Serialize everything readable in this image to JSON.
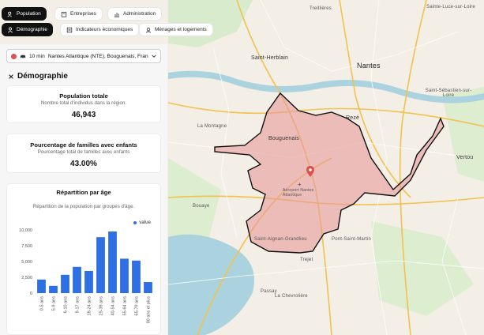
{
  "nav": {
    "row1": [
      {
        "label": "Population",
        "icon": "people-icon",
        "active": true
      },
      {
        "label": "Entreprises",
        "icon": "building-icon",
        "active": false
      },
      {
        "label": "Administration",
        "icon": "chart-icon",
        "active": false
      }
    ],
    "row2": [
      {
        "label": "Démographie",
        "icon": "person-icon",
        "active": true
      },
      {
        "label": "Indicateurs économiques",
        "icon": "list-icon",
        "active": false
      },
      {
        "label": "Ménages et logements",
        "icon": "home-icon",
        "active": false
      }
    ]
  },
  "location": {
    "time": "10 min",
    "place": "Nantes Atlantique (NTE), Bouguenais, Fran"
  },
  "section_title": "Démographie",
  "cards": {
    "population": {
      "title": "Population totale",
      "subtitle": "Nombre total d'individus dans la région.",
      "value": "46,943"
    },
    "families": {
      "title": "Pourcentage de familles avec enfants",
      "subtitle": "Pourcentage total de familles avec enfants",
      "value": "43.00%"
    }
  },
  "age_chart": {
    "title": "Répartition par âge",
    "subtitle": "Répartition de la population par groupes d'âge.",
    "legend": "value"
  },
  "chart_data": {
    "type": "bar",
    "title": "Répartition par âge",
    "categories": [
      "0-5 ans",
      "5-9 ans",
      "6-10 ans",
      "9-17 ans",
      "18-24 ans",
      "25-39 ans",
      "40-54 ans",
      "55-64 ans",
      "65-79 ans",
      "80 ans et plus"
    ],
    "series": [
      {
        "name": "value",
        "values": [
          2150,
          1150,
          2900,
          4150,
          3500,
          8850,
          9750,
          5450,
          5150,
          1750
        ]
      }
    ],
    "ylim": [
      0,
      10000
    ],
    "yticks": [
      "0",
      "2,500",
      "5,000",
      "7,500",
      "10,000"
    ],
    "color": "#2f6fe4"
  },
  "map": {
    "labels": {
      "nantes": "Nantes",
      "saint_herblain": "Saint-Herblain",
      "reze": "Rezé",
      "bouguenais": "Bouguenais",
      "saint_sebastien": "Saint-Sébastien-sur-Loire",
      "vertou": "Vertou",
      "la_montagne": "La Montagne",
      "bouaye": "Bouaye",
      "saint_aignan": "Saint-Aignan-Grandlieu",
      "pont_saint_martin": "Pont-Saint-Martin",
      "la_chevroliere": "La Chevrolière",
      "treillieres": "Treillières",
      "sainte_luce": "Sainte-Luce-sur-Loire",
      "airport": "Aéroport Nantes Atlantique",
      "tregat": "Trejet",
      "passay": "Passay"
    }
  }
}
